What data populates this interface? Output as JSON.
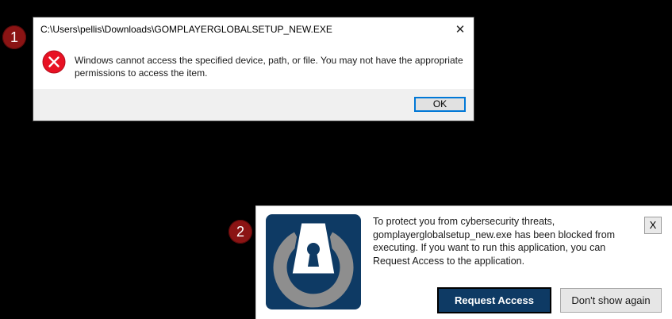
{
  "badges": {
    "first": "1",
    "second": "2"
  },
  "error_dialog": {
    "title": "C:\\Users\\pellis\\Downloads\\GOMPLAYERGLOBALSETUP_NEW.EXE",
    "close_glyph": "✕",
    "icon": "error-icon",
    "icon_color": "#e81123",
    "message": "Windows cannot access the specified device, path, or file. You may not have the appropriate permissions to access the item.",
    "ok_label": "OK"
  },
  "security_popup": {
    "logo": "keyhole-lock-icon",
    "logo_bg_color": "#0e3a64",
    "message": "To protect you from cybersecurity threats, gomplayerglobalsetup_new.exe has been blocked from executing. If you want to run this application, you can Request Access to the application.",
    "close_label": "X",
    "request_access_label": "Request Access",
    "dont_show_label": "Don't show again"
  },
  "colors": {
    "badge": "#8b1414",
    "accent_blue": "#0078d7",
    "background": "#000000"
  }
}
